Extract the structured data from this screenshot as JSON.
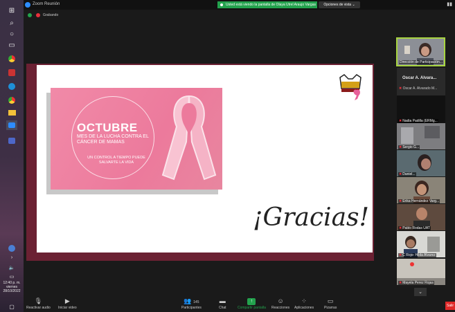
{
  "window": {
    "title": "Zoom Reunión"
  },
  "banner": {
    "text": "Usted está viendo la pantalla de Olaya Utrel Araujo Vargas",
    "options_label": "Opciones de vista ⌄"
  },
  "recording": {
    "label": "Grabando"
  },
  "slide": {
    "card_title": "OCTUBRE",
    "card_subtitle": "MES DE LA LUCHA CONTRA EL CÁNCER DE MAMAS",
    "card_tagline": "UN CONTROL A TIEMPO PUEDE SALVARTE LA VIDA",
    "closing": "¡Gracias!"
  },
  "participants": {
    "self_label": "Dirección de Participación...",
    "host_name": "Oscar A. Alvara...",
    "host_sub": "Oscar A. Alvarado M...",
    "tiles": [
      {
        "name": "Nadia Padilla (ERMg..."
      },
      {
        "name": "Sergio G..."
      },
      {
        "name": "Daniel..."
      },
      {
        "name": "Erika Hernández Varg..."
      },
      {
        "name": "Pablo Rodas UAT"
      },
      {
        "name": "C Rojo- Hilda Alvarez"
      },
      {
        "name": "Mayela Perez Rojas"
      }
    ]
  },
  "toolbar": {
    "mute": "Reactivar audio",
    "video": "Iniciar video",
    "participants_count": "145",
    "participants": "Participantes",
    "chat": "Chat",
    "share": "Compartir pantalla",
    "reactions": "Reacciones",
    "apps": "Aplicaciones",
    "whiteboard": "Pizarras",
    "end": "Salir"
  },
  "taskbar": {
    "time": "12:40 p. m.",
    "day": "viernes",
    "date": "28/10/2022"
  },
  "colors": {
    "accent_green": "#23a24d",
    "slide_border": "#6b2133",
    "card_pink": "#ef84a3",
    "zoom_blue": "#2d8cff"
  }
}
